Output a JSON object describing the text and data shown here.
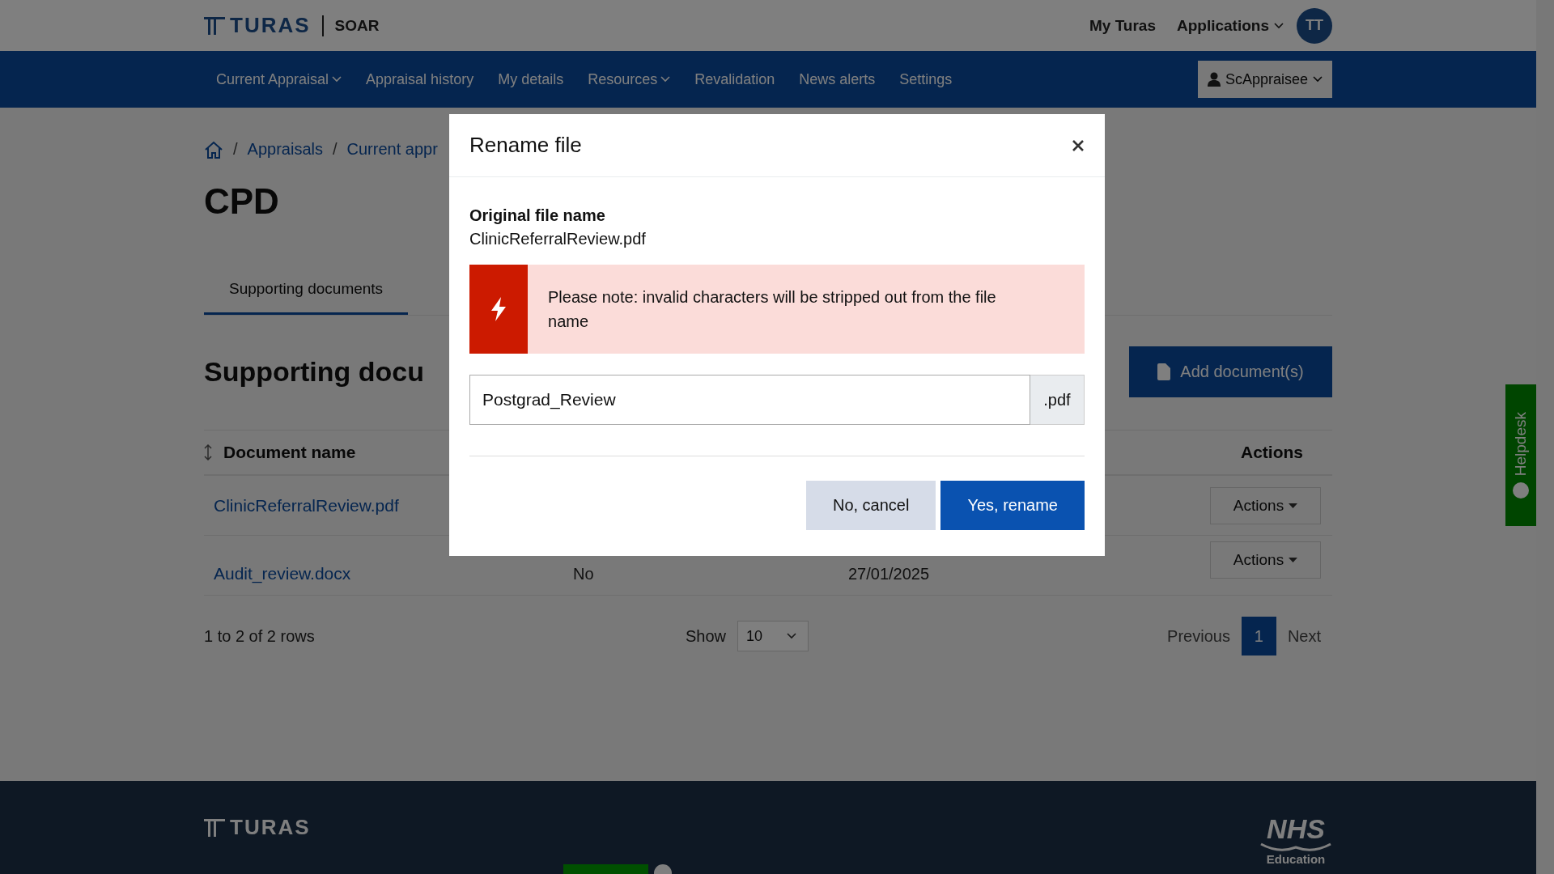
{
  "header": {
    "logo": "TURAS",
    "app": "SOAR",
    "links": [
      {
        "label": "My Turas",
        "dropdown": false
      },
      {
        "label": "Applications",
        "dropdown": true
      }
    ],
    "avatar": "TT"
  },
  "nav": {
    "items": [
      {
        "label": "Current Appraisal",
        "dropdown": true
      },
      {
        "label": "Appraisal history",
        "dropdown": false
      },
      {
        "label": "My details",
        "dropdown": false
      },
      {
        "label": "Resources",
        "dropdown": true
      },
      {
        "label": "Revalidation",
        "dropdown": false
      },
      {
        "label": "News alerts",
        "dropdown": false
      },
      {
        "label": "Settings",
        "dropdown": false
      }
    ],
    "user": "ScAppraisee"
  },
  "breadcrumb": {
    "separator": "/",
    "items": [
      "Appraisals",
      "Current appr"
    ]
  },
  "page_title": "CPD",
  "tabs": [
    {
      "label": "Supporting documents",
      "selected": true
    }
  ],
  "section_title": "Supporting docu",
  "add_button": "Add document(s)",
  "table": {
    "columns": [
      "Document name",
      "Actions"
    ],
    "rows": [
      {
        "name": "ClinicReferralReview.pdf",
        "action": "Actions"
      },
      {
        "name": "Audit_review.docx",
        "column_2": "No",
        "column_3": "27/01/2025",
        "action": "Actions"
      }
    ]
  },
  "table_footer": {
    "summary": "1 to 2 of 2 rows",
    "show_label": "Show",
    "page_size": "10",
    "previous": "Previous",
    "pages": [
      {
        "label": "1",
        "selected": true
      }
    ],
    "next": "Next"
  },
  "helpdesk": "Helpdesk",
  "footer": {
    "logo": "TURAS",
    "nhs": "NHS",
    "nhs_sub": "Education"
  },
  "modal": {
    "title": "Rename file",
    "original_label": "Original file name",
    "original_value": "ClinicReferralReview.pdf",
    "note": "Please note: invalid characters will be stripped out from the file name",
    "input_value": "Postgrad_Review",
    "suffix": ".pdf",
    "cancel": "No, cancel",
    "confirm": "Yes, rename"
  }
}
